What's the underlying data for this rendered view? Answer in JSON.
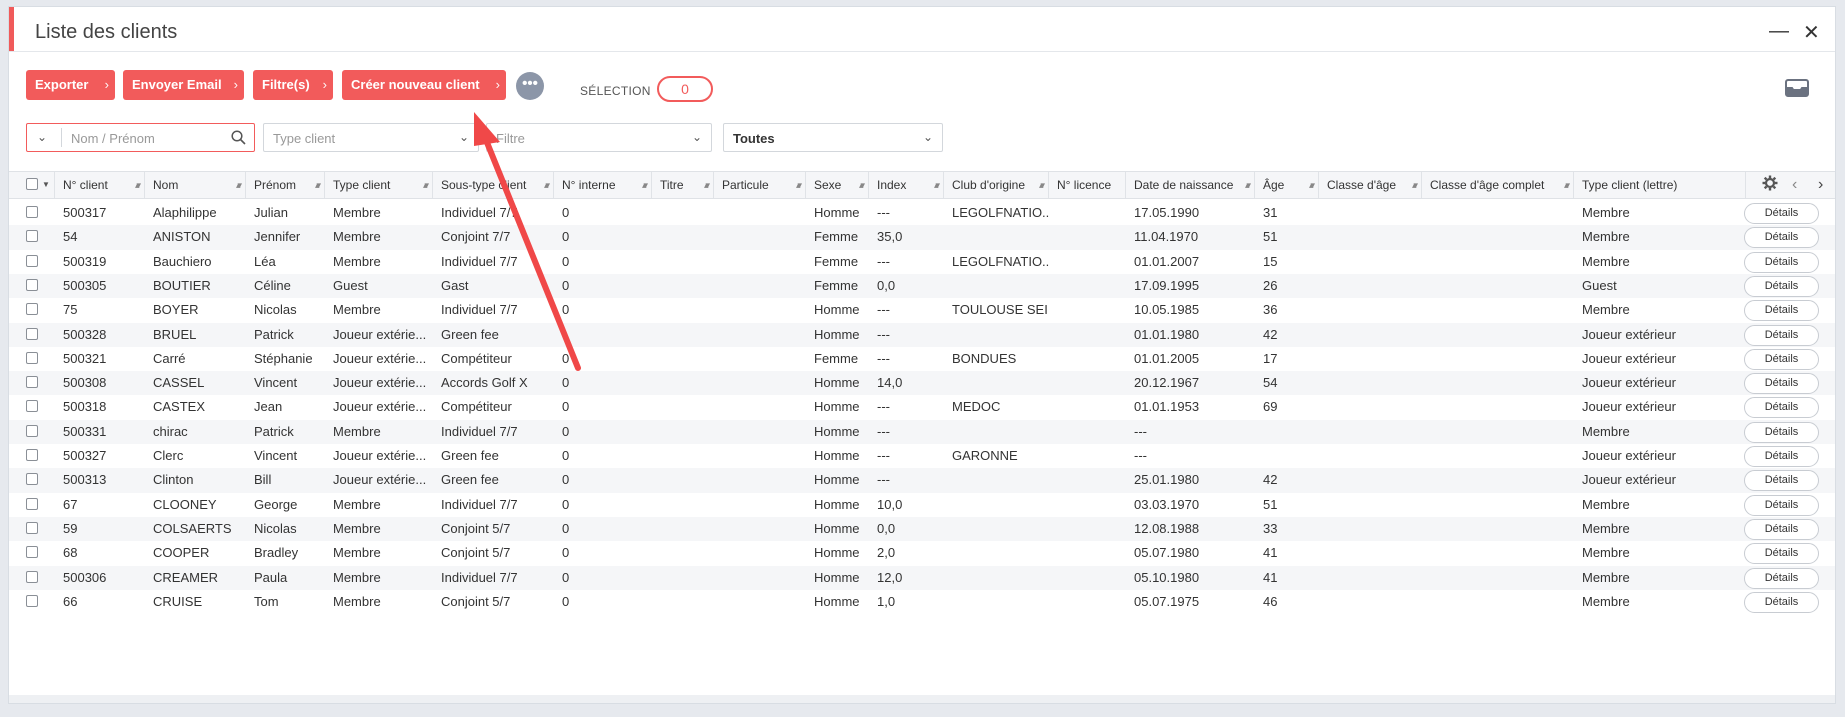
{
  "window": {
    "title": "Liste des clients"
  },
  "toolbar": {
    "export_label": "Exporter",
    "email_label": "Envoyer Email",
    "filters_label": "Filtre(s)",
    "new_client_label": "Créer nouveau client",
    "more_label": "•••",
    "selection_label": "SÉLECTION",
    "selection_count": "0"
  },
  "filters": {
    "search_placeholder": "Nom / Prénom",
    "type_placeholder": "Type client",
    "filter_placeholder": "Filtre",
    "status_value": "Toutes"
  },
  "columns": [
    "N° client",
    "Nom",
    "Prénom",
    "Type client",
    "Sous-type client",
    "N° interne",
    "Titre",
    "Particule",
    "Sexe",
    "Index",
    "Club d'origine",
    "N° licence",
    "Date de naissance",
    "Âge",
    "Classe d'âge",
    "Classe d'âge complet",
    "Type client (lettre)"
  ],
  "details_label": "Détails",
  "rows": [
    [
      "500317",
      "Alaphilippe",
      "Julian",
      "Membre",
      "Individuel 7/7",
      "0",
      "",
      "",
      "Homme",
      "---",
      "LEGOLFNATIO...",
      "",
      "17.05.1990",
      "31",
      "",
      "",
      "Membre"
    ],
    [
      "54",
      "ANISTON",
      "Jennifer",
      "Membre",
      "Conjoint 7/7",
      "0",
      "",
      "",
      "Femme",
      "35,0",
      "",
      "",
      "11.04.1970",
      "51",
      "",
      "",
      "Membre"
    ],
    [
      "500319",
      "Bauchiero",
      "Léa",
      "Membre",
      "Individuel 7/7",
      "0",
      "",
      "",
      "Femme",
      "---",
      "LEGOLFNATIO...",
      "",
      "01.01.2007",
      "15",
      "",
      "",
      "Membre"
    ],
    [
      "500305",
      "BOUTIER",
      "Céline",
      "Guest",
      "Gast",
      "0",
      "",
      "",
      "Femme",
      "0,0",
      "",
      "",
      "17.09.1995",
      "26",
      "",
      "",
      "Guest"
    ],
    [
      "75",
      "BOYER",
      "Nicolas",
      "Membre",
      "Individuel 7/7",
      "0",
      "",
      "",
      "Homme",
      "---",
      "TOULOUSE SEI...",
      "",
      "10.05.1985",
      "36",
      "",
      "",
      "Membre"
    ],
    [
      "500328",
      "BRUEL",
      "Patrick",
      "Joueur extérie...",
      "Green fee",
      "",
      "",
      "",
      "Homme",
      "---",
      "",
      "",
      "01.01.1980",
      "42",
      "",
      "",
      "Joueur extérieur"
    ],
    [
      "500321",
      "Carré",
      "Stéphanie",
      "Joueur extérie...",
      "Compétiteur",
      "0",
      "",
      "",
      "Femme",
      "---",
      "BONDUES",
      "",
      "01.01.2005",
      "17",
      "",
      "",
      "Joueur extérieur"
    ],
    [
      "500308",
      "CASSEL",
      "Vincent",
      "Joueur extérie...",
      "Accords Golf X",
      "0",
      "",
      "",
      "Homme",
      "14,0",
      "",
      "",
      "20.12.1967",
      "54",
      "",
      "",
      "Joueur extérieur"
    ],
    [
      "500318",
      "CASTEX",
      "Jean",
      "Joueur extérie...",
      "Compétiteur",
      "0",
      "",
      "",
      "Homme",
      "---",
      "MEDOC",
      "",
      "01.01.1953",
      "69",
      "",
      "",
      "Joueur extérieur"
    ],
    [
      "500331",
      "chirac",
      "Patrick",
      "Membre",
      "Individuel 7/7",
      "0",
      "",
      "",
      "Homme",
      "---",
      "",
      "",
      "---",
      "",
      "",
      "",
      "Membre"
    ],
    [
      "500327",
      "Clerc",
      "Vincent",
      "Joueur extérie...",
      "Green fee",
      "0",
      "",
      "",
      "Homme",
      "---",
      "GARONNE",
      "",
      "---",
      "",
      "",
      "",
      "Joueur extérieur"
    ],
    [
      "500313",
      "Clinton",
      "Bill",
      "Joueur extérie...",
      "Green fee",
      "0",
      "",
      "",
      "Homme",
      "---",
      "",
      "",
      "25.01.1980",
      "42",
      "",
      "",
      "Joueur extérieur"
    ],
    [
      "67",
      "CLOONEY",
      "George",
      "Membre",
      "Individuel 7/7",
      "0",
      "",
      "",
      "Homme",
      "10,0",
      "",
      "",
      "03.03.1970",
      "51",
      "",
      "",
      "Membre"
    ],
    [
      "59",
      "COLSAERTS",
      "Nicolas",
      "Membre",
      "Conjoint 5/7",
      "0",
      "",
      "",
      "Homme",
      "0,0",
      "",
      "",
      "12.08.1988",
      "33",
      "",
      "",
      "Membre"
    ],
    [
      "68",
      "COOPER",
      "Bradley",
      "Membre",
      "Conjoint 5/7",
      "0",
      "",
      "",
      "Homme",
      "2,0",
      "",
      "",
      "05.07.1980",
      "41",
      "",
      "",
      "Membre"
    ],
    [
      "500306",
      "CREAMER",
      "Paula",
      "Membre",
      "Individuel 7/7",
      "0",
      "",
      "",
      "Homme",
      "12,0",
      "",
      "",
      "05.10.1980",
      "41",
      "",
      "",
      "Membre"
    ],
    [
      "66",
      "CRUISE",
      "Tom",
      "Membre",
      "Conjoint 5/7",
      "0",
      "",
      "",
      "Homme",
      "1,0",
      "",
      "",
      "05.07.1975",
      "46",
      "",
      "",
      "Membre"
    ]
  ],
  "colors": {
    "accent": "#f25b5b",
    "annotation_arrow": "#f04848"
  }
}
